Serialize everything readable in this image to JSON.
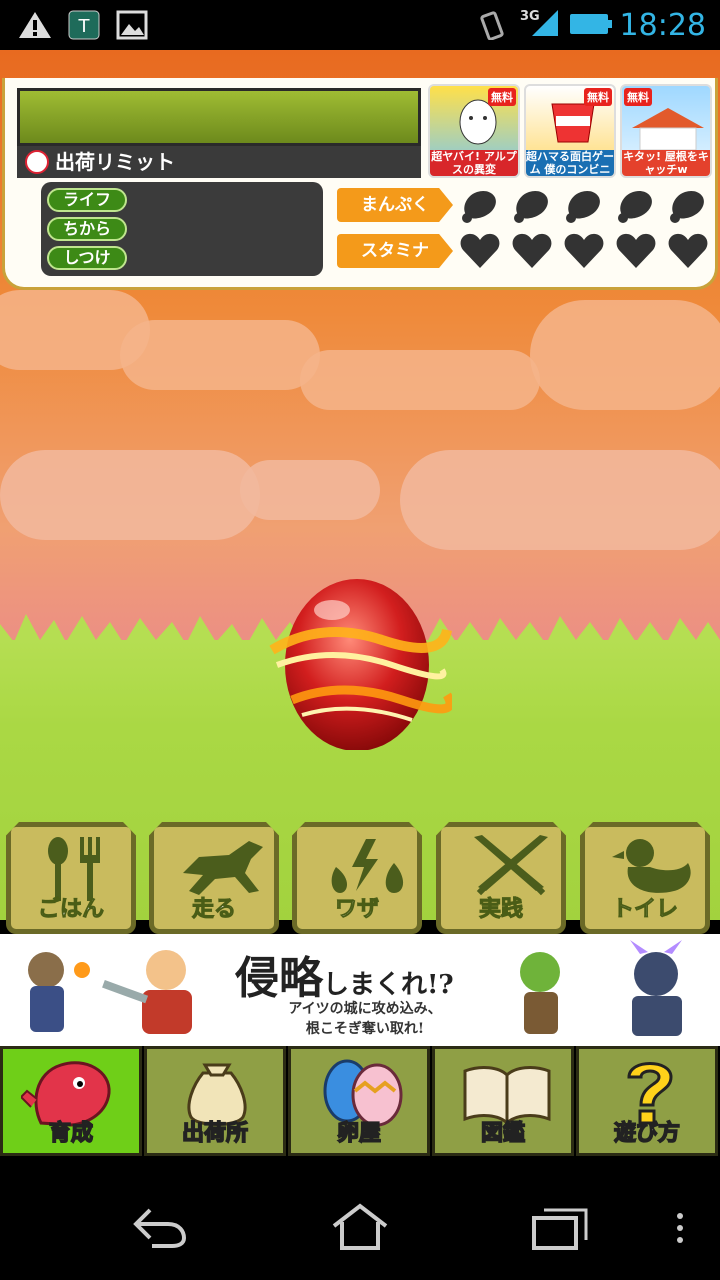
{
  "status_bar": {
    "time": "18:28",
    "network": "3G",
    "icons": [
      "warning-icon",
      "shield-app-icon",
      "image-icon",
      "vibrate-icon",
      "signal-icon",
      "battery-icon"
    ]
  },
  "hud": {
    "shipping_limit_label": "出荷リミット",
    "stats": [
      "ライフ",
      "ちから",
      "しつけ"
    ],
    "gauges": {
      "fullness_label": "まんぷく",
      "stamina_label": "スタミナ",
      "fullness_value": 0,
      "stamina_value": 0,
      "max": 5
    }
  },
  "ads": [
    {
      "badge": "無料",
      "caption": "超ヤバイ! アルプスの異変"
    },
    {
      "badge": "無料",
      "caption": "超ハマる面白ゲーム 僕のコンビニ"
    },
    {
      "badge": "無料",
      "caption": "キタッ! 屋根をキャッチw"
    }
  ],
  "actions": [
    {
      "label": "ごはん",
      "icon": "food-icon"
    },
    {
      "label": "走る",
      "icon": "run-icon"
    },
    {
      "label": "ワザ",
      "icon": "element-icon"
    },
    {
      "label": "実践",
      "icon": "swords-icon"
    },
    {
      "label": "トイレ",
      "icon": "duck-icon"
    }
  ],
  "banner": {
    "title": "侵略",
    "title_tail": "しまくれ!?",
    "line1": "アイツの城に攻め込み、",
    "line2": "根こそぎ奪い取れ!"
  },
  "nav": [
    {
      "label": "育成",
      "icon": "dino-icon",
      "active": true
    },
    {
      "label": "出荷所",
      "icon": "money-bag-icon",
      "active": false
    },
    {
      "label": "卵屋",
      "icon": "eggs-icon",
      "active": false
    },
    {
      "label": "図鑑",
      "icon": "book-icon",
      "active": false
    },
    {
      "label": "遊び方",
      "icon": "question-icon",
      "active": false
    }
  ],
  "colors": {
    "accent_orange": "#f49a1a",
    "stat_green": "#3d8a16",
    "active_nav": "#6fcf18",
    "clock_blue": "#33b5e5"
  }
}
